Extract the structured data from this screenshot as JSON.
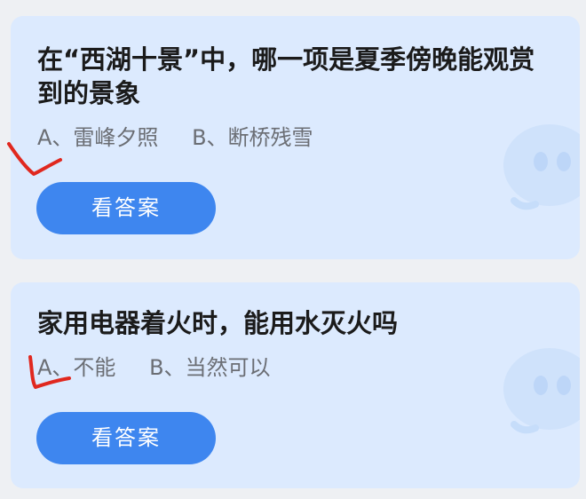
{
  "cards": [
    {
      "question": "在“西湖十景”中，哪一项是夏季傍晚能观赏到的景象",
      "option_a": "A、雷峰夕照",
      "option_b": "B、断桥残雪",
      "button_label": "看答案",
      "mascot_icon": "mascot-watermark-icon"
    },
    {
      "question": "家用电器着火时，能用水灭火吗",
      "option_a": "A、不能",
      "option_b": "B、当然可以",
      "button_label": "看答案",
      "mascot_icon": "mascot-watermark-icon"
    }
  ],
  "annotations": {
    "mark_icon": "handwritten-check-icon",
    "mark_color": "#e0281f"
  },
  "colors": {
    "card_background": "#dceafe",
    "button_background": "#3e86ef",
    "question_text": "#1b1b1b",
    "option_text": "#6b6e74"
  }
}
